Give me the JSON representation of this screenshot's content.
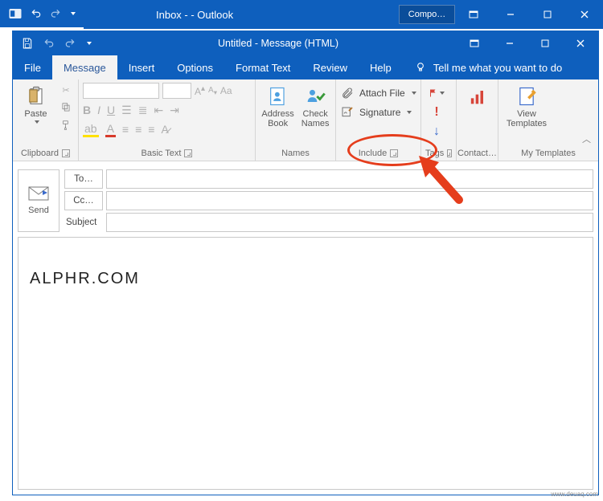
{
  "parent_window": {
    "title": "Inbox -                                        - Outlook",
    "tab_button": "Compo…"
  },
  "compose_window": {
    "title": "Untitled  -  Message (HTML)",
    "menu": {
      "file": "File",
      "message": "Message",
      "insert": "Insert",
      "options": "Options",
      "format_text": "Format Text",
      "review": "Review",
      "help": "Help",
      "tell_me": "Tell me what you want to do"
    },
    "ribbon": {
      "clipboard": {
        "paste": "Paste",
        "label": "Clipboard"
      },
      "basic_text": {
        "label": "Basic Text"
      },
      "names": {
        "address_book": "Address Book",
        "check_names": "Check Names",
        "label": "Names"
      },
      "include": {
        "attach_file": "Attach File",
        "signature": "Signature",
        "label": "Include"
      },
      "tags": {
        "label": "Tags"
      },
      "contacts": {
        "label": "Contact…"
      },
      "templates": {
        "view_templates": "View Templates",
        "label": "My Templates"
      }
    },
    "fields": {
      "send": "Send",
      "to": "To…",
      "cc": "Cc…",
      "subject": "Subject"
    },
    "body_text": "ALPHR.COM"
  },
  "watermark": "www.deuaq.com",
  "colors": {
    "titlebar": "#0e5fbd",
    "highlight": "#e53d1c"
  }
}
